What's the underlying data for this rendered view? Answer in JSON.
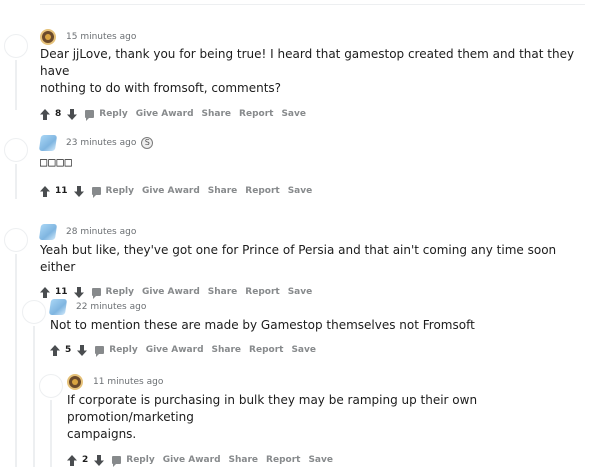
{
  "comments": [
    {
      "time": "15 minutes ago",
      "avatar_icon": "user-avatar-brown",
      "text_line1": "Dear jjLove, thank you for being true! I heard that gamestop created them and that they have",
      "text_line2": "nothing to do with fromsoft, comments?",
      "score": "8",
      "reply": "Reply",
      "give_award": "Give Award",
      "share": "Share",
      "report": "Report",
      "save": "Save"
    },
    {
      "time": "23 minutes ago",
      "avatar_icon": "user-avatar-blue",
      "award_glyph": "S",
      "text": "□□□□",
      "score": "11",
      "reply": "Reply",
      "give_award": "Give Award",
      "share": "Share",
      "report": "Report",
      "save": "Save"
    },
    {
      "time": "28 minutes ago",
      "avatar_icon": "user-avatar-blue",
      "text": "Yeah but like, they've got one for Prince of Persia and that ain't coming any time soon either",
      "score": "11",
      "reply": "Reply",
      "give_award": "Give Award",
      "share": "Share",
      "report": "Report",
      "save": "Save"
    },
    {
      "time": "22 minutes ago",
      "avatar_icon": "user-avatar-blue",
      "text": "Not to mention these are made by Gamestop themselves not Fromsoft",
      "score": "5",
      "reply": "Reply",
      "give_award": "Give Award",
      "share": "Share",
      "report": "Report",
      "save": "Save"
    },
    {
      "time": "11 minutes ago",
      "avatar_icon": "user-avatar-brown",
      "text_line1": "If corporate is purchasing in bulk they may be ramping up their own promotion/marketing",
      "text_line2": "campaigns.",
      "score": "2",
      "reply": "Reply",
      "give_award": "Give Award",
      "share": "Share",
      "report": "Report",
      "save": "Save"
    }
  ],
  "colors": {
    "text": "#1c1c1c",
    "meta": "#878a8c",
    "thread_line": "#edeff1"
  }
}
